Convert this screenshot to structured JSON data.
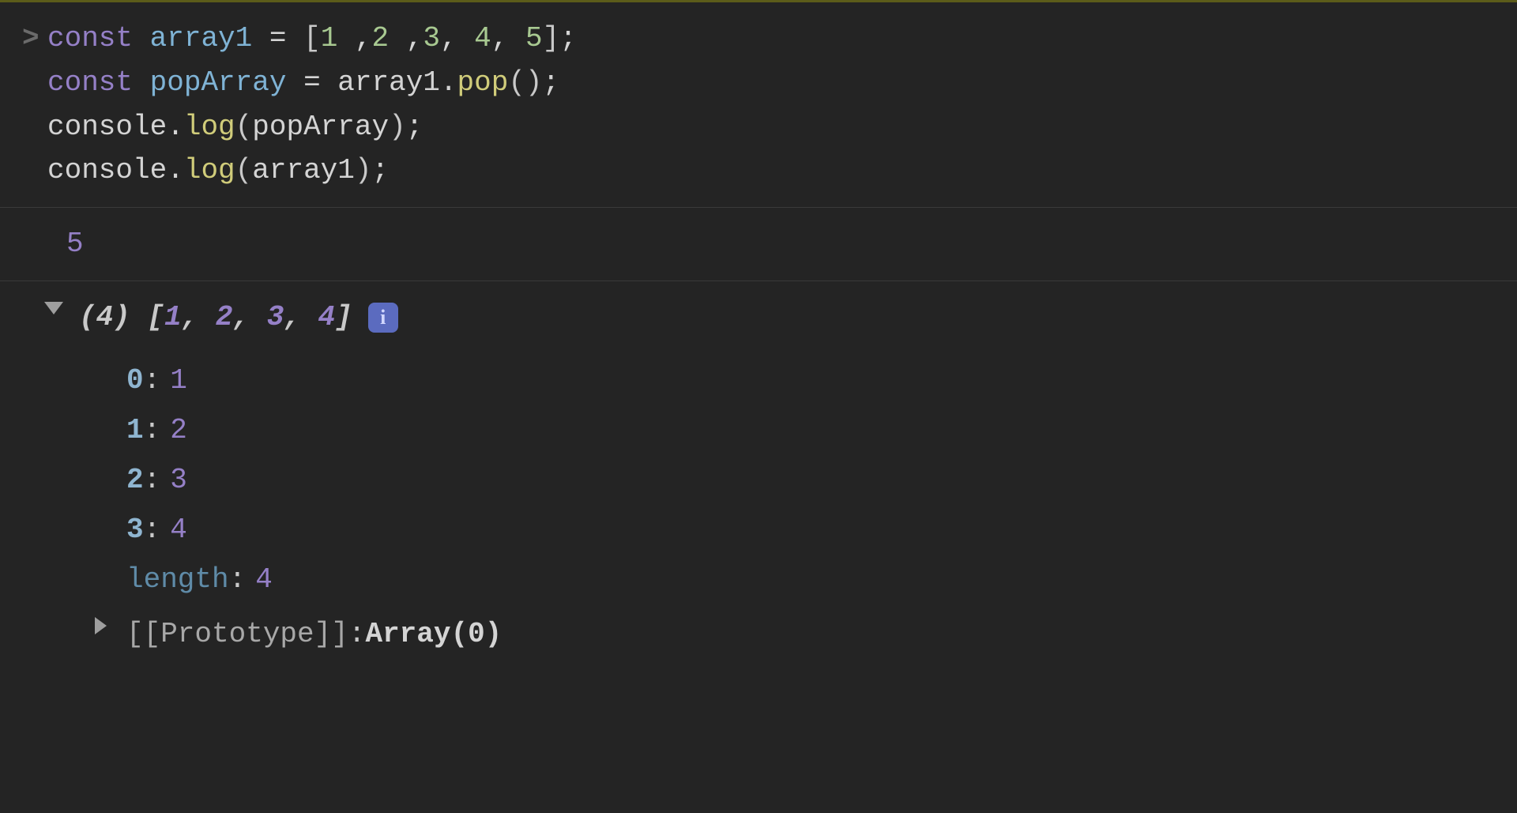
{
  "input": {
    "prompt": ">",
    "lines": {
      "l1": {
        "kw": "const",
        "var": "array1",
        "eq": " = ",
        "lb": "[",
        "n1": "1",
        "c1": " ,",
        "n2": "2",
        "c2": " ,",
        "n3": "3",
        "c3": ", ",
        "n4": "4",
        "c4": ", ",
        "n5": "5",
        "rb": "]",
        "semi": ";"
      },
      "l2": {
        "kw": "const",
        "var": "popArray",
        "eq": " = ",
        "obj": "array1",
        "dot": ".",
        "method": "pop",
        "paren": "()",
        "semi": ";"
      },
      "l3": {
        "obj": "console",
        "dot": ".",
        "method": "log",
        "lp": "(",
        "arg": "popArray",
        "rp": ")",
        "semi": ";"
      },
      "l4": {
        "obj": "console",
        "dot": ".",
        "method": "log",
        "lp": "(",
        "arg": "array1",
        "rp": ")",
        "semi": ";"
      }
    }
  },
  "output1": {
    "value": "5"
  },
  "output2": {
    "summary": {
      "len": "(4)",
      "lb": "[",
      "v1": "1",
      "c": ", ",
      "v2": "2",
      "v3": "3",
      "v4": "4",
      "rb": "]",
      "info": "i"
    },
    "props": {
      "p0": {
        "key": "0",
        "colon": ":",
        "val": "1"
      },
      "p1": {
        "key": "1",
        "colon": ":",
        "val": "2"
      },
      "p2": {
        "key": "2",
        "colon": ":",
        "val": "3"
      },
      "p3": {
        "key": "3",
        "colon": ":",
        "val": "4"
      },
      "length": {
        "key": "length",
        "colon": ":",
        "val": "4"
      },
      "proto": {
        "key": "[[Prototype]]",
        "colon": ": ",
        "val": "Array(0)"
      }
    }
  }
}
